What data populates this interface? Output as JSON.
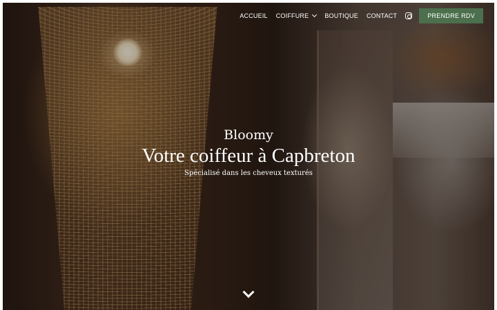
{
  "nav": {
    "items": [
      {
        "label": "ACCUEIL"
      },
      {
        "label": "COIFFURE",
        "has_dropdown": true
      },
      {
        "label": "BOUTIQUE"
      },
      {
        "label": "CONTACT"
      }
    ],
    "social_icon": "instagram-icon",
    "cta_label": "PRENDRE RDV",
    "cta_color": "#4c6f4d"
  },
  "hero": {
    "brand": "Bloomy",
    "headline": "Votre coiffeur à Capbreton",
    "tagline": "Spécialisé dans les cheveux texturés",
    "scroll_icon": "chevron-down-icon"
  }
}
